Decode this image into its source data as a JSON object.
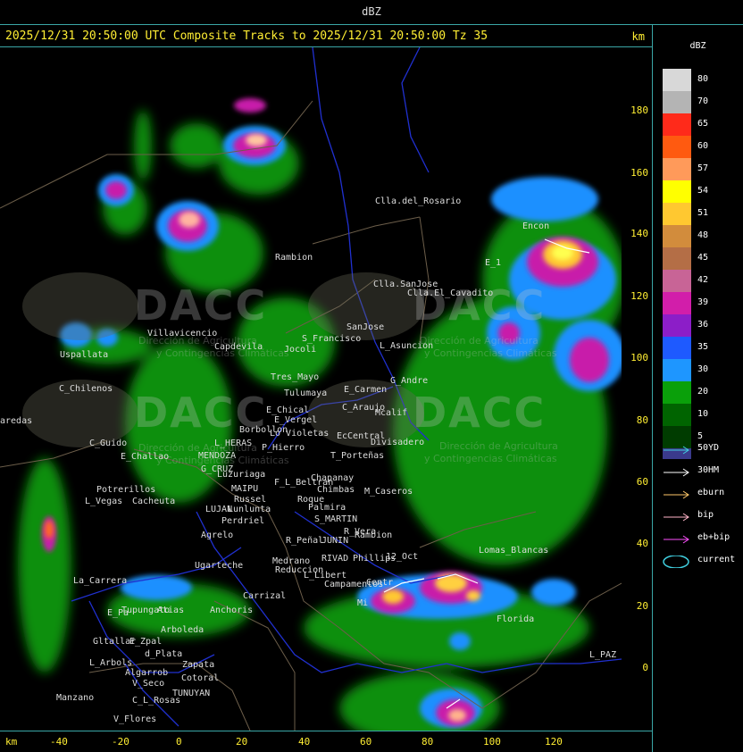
{
  "window": {
    "title": "dBZ"
  },
  "header": {
    "title": "2025/12/31 20:50:00 UTC Composite Tracks to 2025/12/31 20:50:00 Tz 35",
    "unit": "km"
  },
  "y_axis": {
    "ticks": [
      "180",
      "160",
      "140",
      "120",
      "100",
      "80",
      "60",
      "40",
      "20",
      "0"
    ]
  },
  "x_axis": {
    "unit": "km",
    "ticks": [
      "-40",
      "-20",
      "0",
      "20",
      "40",
      "60",
      "80",
      "100",
      "120"
    ]
  },
  "legend": {
    "title": "dBZ",
    "levels": [
      {
        "label": "80",
        "color": "#d8d8d8"
      },
      {
        "label": "70",
        "color": "#b4b4b4"
      },
      {
        "label": "65",
        "color": "#ff2a1a"
      },
      {
        "label": "60",
        "color": "#ff5a10"
      },
      {
        "label": "57",
        "color": "#ff9a5a"
      },
      {
        "label": "54",
        "color": "#ffff00"
      },
      {
        "label": "51",
        "color": "#ffc830"
      },
      {
        "label": "48",
        "color": "#d28c3c"
      },
      {
        "label": "45",
        "color": "#b46e46"
      },
      {
        "label": "42",
        "color": "#c86496"
      },
      {
        "label": "39",
        "color": "#d21eaa"
      },
      {
        "label": "36",
        "color": "#8c1ec8"
      },
      {
        "label": "35",
        "color": "#1e5aff"
      },
      {
        "label": "30",
        "color": "#1e96ff"
      },
      {
        "label": "20",
        "color": "#0aa00a"
      },
      {
        "label": "10",
        "color": "#006400"
      },
      {
        "label": "5",
        "color": "#003c00"
      }
    ],
    "extra_level": {
      "label": "",
      "color": "#3a3a8c"
    }
  },
  "tracks": [
    {
      "label": "50YD",
      "color": "#40d0e0"
    },
    {
      "label": "30HM",
      "color": "#ffffff"
    },
    {
      "label": "eburn",
      "color": "#ffc86a"
    },
    {
      "label": "bip",
      "color": "#ffb4c8"
    },
    {
      "label": "eb+bip",
      "color": "#ff50ff"
    },
    {
      "label": "current",
      "color": "#40d0e0"
    }
  ],
  "watermark": {
    "brand": "DACC",
    "subtitle_1": "Dirección de Agricultura",
    "subtitle_2": "y Contingencias Climáticas"
  },
  "places": [
    "Clla.del_Rosario",
    "Encon",
    "E_1",
    "Clla.SanJose",
    "Clla.El_Cavadito",
    "Rambion",
    "SanJose",
    "L_Asuncion",
    "Villavicencio",
    "Capdevila",
    "S_Francisco",
    "Jocoli",
    "Uspallata",
    "C_Chilenos",
    "Tres_Mayo",
    "Tulumaya",
    "E_Carmen",
    "G_Andre",
    "E_Chical",
    "E_Vergel",
    "C_Araujo",
    "Mcalif",
    "Borbollon",
    "Lo Violetas",
    "EcCentral",
    "Divisadero",
    "L_HERAS",
    "P_Hierro",
    "C_Guido",
    "E_Challao",
    "MENDOZA",
    "G_CRUZ",
    "T_Porteñas",
    "Luzuriaga",
    "F_L_Beltran",
    "Chapanay",
    "Chimbas",
    "M_Caseros",
    "Potrerillos",
    "Cacheuta",
    "L_Vegas",
    "MAIPU",
    "Russel",
    "Roque",
    "Palmira",
    "LUJAN",
    "Lunlunta",
    "S_MARTIN",
    "Perdriel",
    "R_Vera",
    "Rambion",
    "Agrelo",
    "R_Peñal",
    "JUNIN",
    "RIVAD",
    "Phillips",
    "12_Oct",
    "Lomas_Blancas",
    "Ugarteche",
    "La_Carrera",
    "Medrano",
    "Anchoris",
    "Carrizal",
    "Reduccion",
    "L_Libert",
    "Campamentos",
    "Centr",
    "Tupungato",
    "E_Pa",
    "Atias",
    "Arboleda",
    "Mi",
    "Florida",
    "Gltallar",
    "E_Zpal",
    "d_Plata",
    "L_Arbols",
    "Zapata",
    "Algarrob",
    "V_Seco",
    "Cotoral",
    "Manzano",
    "TUNUYAN",
    "C_L_Rosas",
    "V_Flores",
    "L_PAZ",
    "aredas"
  ]
}
